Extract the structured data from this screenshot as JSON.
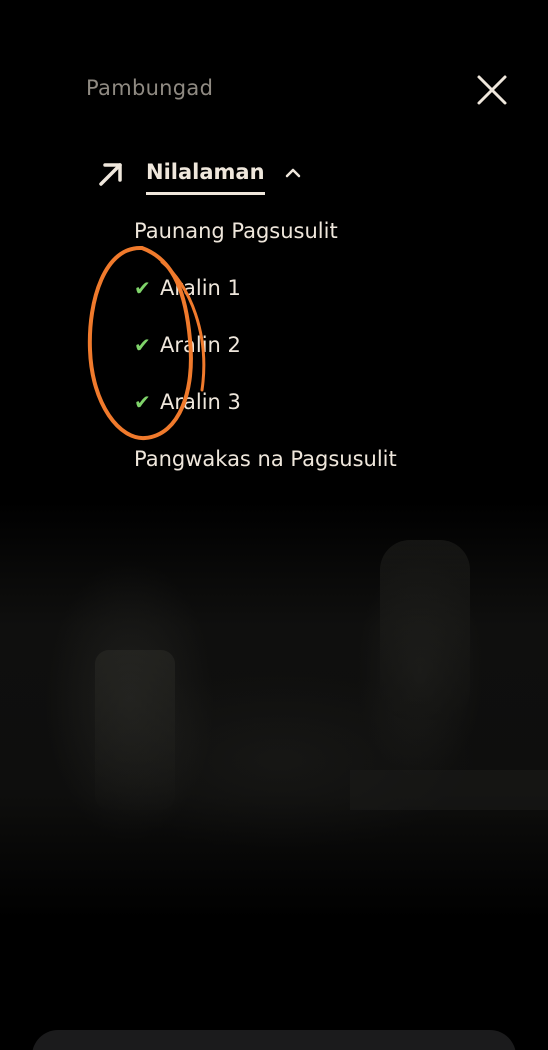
{
  "header": {
    "title": "Pambungad"
  },
  "nav": {
    "current_label": "Nilalaman"
  },
  "menu": {
    "items": [
      {
        "label": "Paunang Pagsusulit",
        "checked": false
      },
      {
        "label": "Aralin 1",
        "checked": true
      },
      {
        "label": "Aralin 2",
        "checked": true
      },
      {
        "label": "Aralin 3",
        "checked": true
      },
      {
        "label": "Pangwakas na Pagsusulit",
        "checked": false
      }
    ],
    "check_glyph": "✔"
  },
  "colors": {
    "text": "#efe7dc",
    "muted": "#8f8a82",
    "check": "#7fd36a",
    "annotation": "#f07a2c"
  },
  "icons": {
    "close": "close-icon",
    "arrow": "arrow-up-right-icon",
    "chevron": "chevron-up-icon",
    "check": "check-icon"
  }
}
